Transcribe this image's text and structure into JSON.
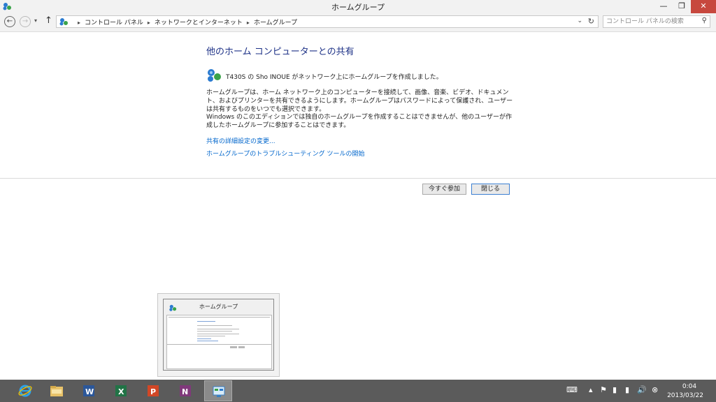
{
  "window": {
    "title": "ホームグループ",
    "minimize_icon": "—",
    "restore_icon": "❐",
    "close_icon": "✕"
  },
  "nav": {
    "back_icon": "←",
    "forward_icon": "→",
    "dropdown_icon": "▾",
    "up_icon": "↑",
    "breadcrumbs": [
      "コントロール パネル",
      "ネットワークとインターネット",
      "ホームグループ"
    ],
    "separator": "▸",
    "address_dropdown_icon": "⌄",
    "refresh_icon": "↻",
    "search_placeholder": "コントロール パネルの検索",
    "search_icon": "⚲"
  },
  "content": {
    "heading": "他のホーム コンピューターとの共有",
    "creator_message": "T430S の Sho INOUE がネットワーク上にホームグループを作成しました。",
    "paragraph1": "ホームグループは、ホーム ネットワーク上のコンピューターを接続して、画像、音楽、ビデオ、ドキュメント、およびプリンターを共有できるようにします。ホームグループはパスワードによって保護され、ユーザーは共有するものをいつでも選択できます。",
    "paragraph2": "Windows のこのエディションでは独自のホームグループを作成することはできませんが、他のユーザーが作成したホームグループに参加することはできます。",
    "link_advanced": "共有の詳細設定の変更...",
    "link_troubleshoot": "ホームグループのトラブルシューティング ツールの開始",
    "button_join": "今すぐ参加",
    "button_close": "閉じる"
  },
  "thumbnail": {
    "title": "ホームグループ"
  },
  "taskbar": {
    "apps": [
      "internet-explorer",
      "file-explorer",
      "word",
      "excel",
      "powerpoint",
      "onenote",
      "control-panel"
    ],
    "tray": {
      "keyboard_icon": "⌨",
      "show_hidden_icon": "▴",
      "flag_icon": "⚑",
      "network_icon": "▮",
      "volume_icon": "🔊",
      "close_icon": "⊗"
    },
    "time": "0:04",
    "date": "2013/03/22"
  },
  "colors": {
    "heading": "#1e3287",
    "link": "#0066cc",
    "close_button": "#c7483e",
    "taskbar": "#5b5b5b"
  }
}
